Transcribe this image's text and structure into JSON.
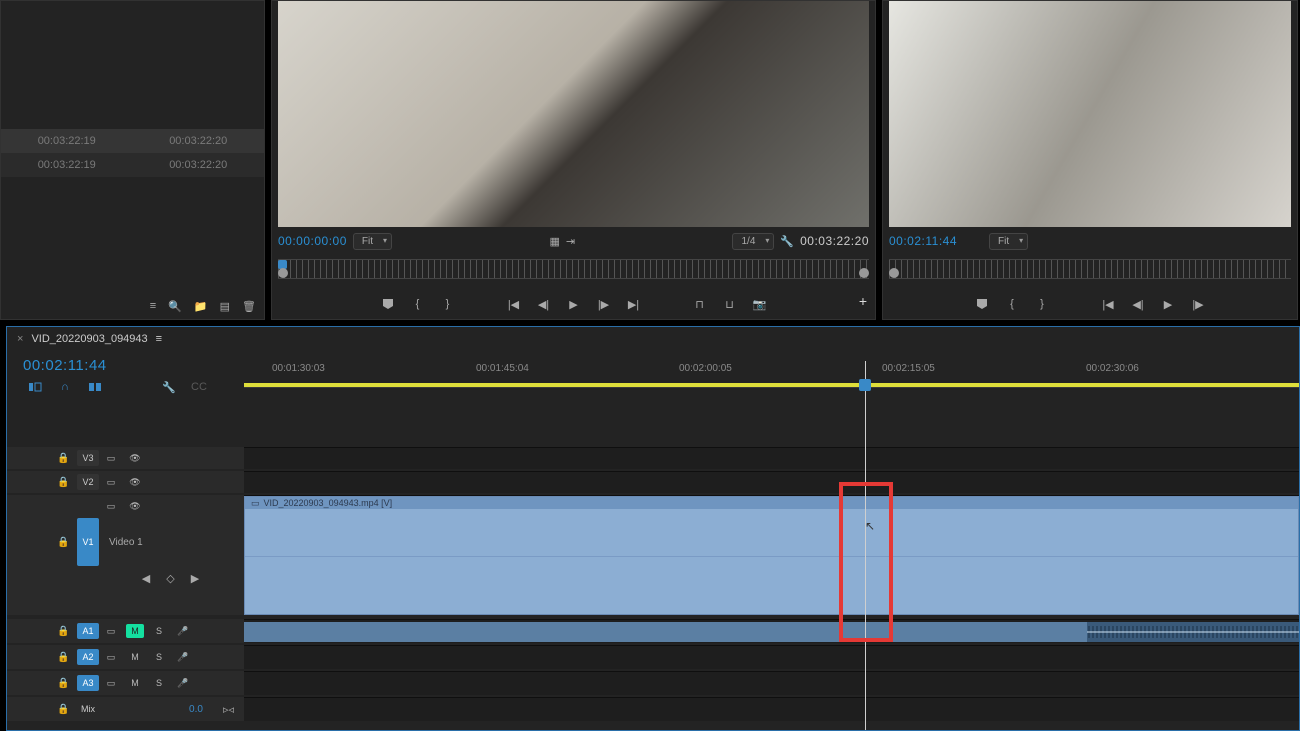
{
  "project": {
    "rows": [
      {
        "in": "00:03:22:19",
        "out": "00:03:22:20"
      },
      {
        "in": "00:03:22:19",
        "out": "00:03:22:20"
      }
    ]
  },
  "source_monitor": {
    "tc_left": "00:00:00:00",
    "zoom": "Fit",
    "resolution": "1/4",
    "tc_right": "00:03:22:20"
  },
  "program_monitor": {
    "tc_left": "00:02:11:44",
    "zoom": "Fit"
  },
  "timeline": {
    "sequence_name": "VID_20220903_094943",
    "tc": "00:02:11:44",
    "ruler_labels": [
      "00:01:30:03",
      "00:01:45:04",
      "00:02:00:05",
      "00:02:15:05",
      "00:02:30:06"
    ],
    "clip_name": "VID_20220903_094943.mp4 [V]",
    "video_tracks": [
      {
        "tag": "V3",
        "lit": false
      },
      {
        "tag": "V2",
        "lit": false
      },
      {
        "tag": "V1",
        "lit": true,
        "label": "Video 1"
      }
    ],
    "audio_tracks": [
      {
        "tag": "A1",
        "lit": true,
        "mute": "M",
        "solo": "S",
        "mute_green": true
      },
      {
        "tag": "A2",
        "lit": true,
        "mute": "M",
        "solo": "S",
        "mute_green": false
      },
      {
        "tag": "A3",
        "lit": true,
        "mute": "M",
        "solo": "S",
        "mute_green": false
      }
    ],
    "mix": {
      "label": "Mix",
      "value": "0.0"
    }
  }
}
